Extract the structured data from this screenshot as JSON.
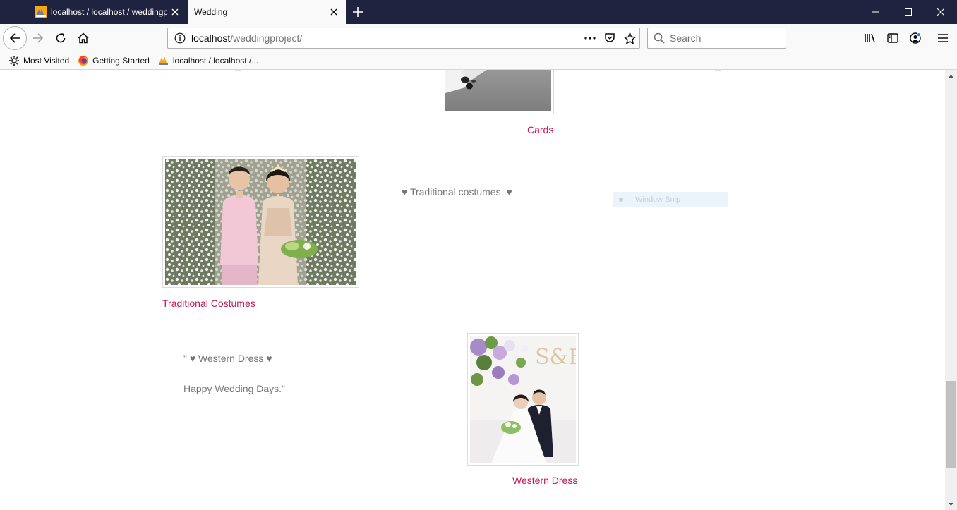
{
  "browser": {
    "tabs": [
      {
        "title": "localhost / localhost / weddingpro",
        "active": false
      },
      {
        "title": "Wedding",
        "active": true
      }
    ],
    "url_host": "localhost",
    "url_path": "/weddingproject/",
    "search_placeholder": "Search",
    "bookmarks": [
      {
        "label": "Most Visited",
        "icon": "gear-icon"
      },
      {
        "label": "Getting Started",
        "icon": "firefox-icon"
      },
      {
        "label": "localhost / localhost /...",
        "icon": "phpmyadmin-icon"
      }
    ]
  },
  "page": {
    "cards_caption": "Cards",
    "traditional": {
      "caption": "Traditional Costumes",
      "description": "♥ Traditional costumes. ♥"
    },
    "western": {
      "caption": "Western Dress",
      "description_line1": "\" ♥ Western Dress ♥",
      "description_line2": "Happy Wedding Days.\""
    },
    "overlay_label": "Window Snip",
    "photo_text": "S&E"
  },
  "colors": {
    "titlebar": "#202340",
    "caption_accent": "#c2185b",
    "description_text": "#757575"
  }
}
